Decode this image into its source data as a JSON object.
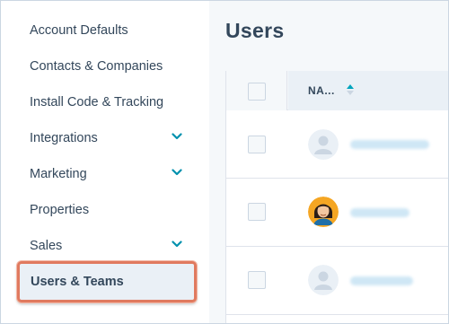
{
  "sidebar": {
    "items": [
      {
        "label": "Account Defaults",
        "has_chevron": false
      },
      {
        "label": "Contacts & Companies",
        "has_chevron": false
      },
      {
        "label": "Install Code & Tracking",
        "has_chevron": false
      },
      {
        "label": "Integrations",
        "has_chevron": true
      },
      {
        "label": "Marketing",
        "has_chevron": true
      },
      {
        "label": "Properties",
        "has_chevron": false
      },
      {
        "label": "Sales",
        "has_chevron": true
      },
      {
        "label": "Users & Teams",
        "has_chevron": false,
        "active": true
      }
    ],
    "chevron_icon": "chevron-down-icon",
    "chevron_color": "#0091ae",
    "highlight_color": "#e07a5f"
  },
  "main": {
    "title": "Users",
    "table": {
      "columns": [
        {
          "label": "NA...",
          "sort_icon": "sort-ascending-icon"
        }
      ],
      "rows": [
        {
          "avatar": "default-avatar-icon"
        },
        {
          "avatar": "user-photo-avatar"
        },
        {
          "avatar": "default-avatar-icon"
        }
      ]
    }
  }
}
